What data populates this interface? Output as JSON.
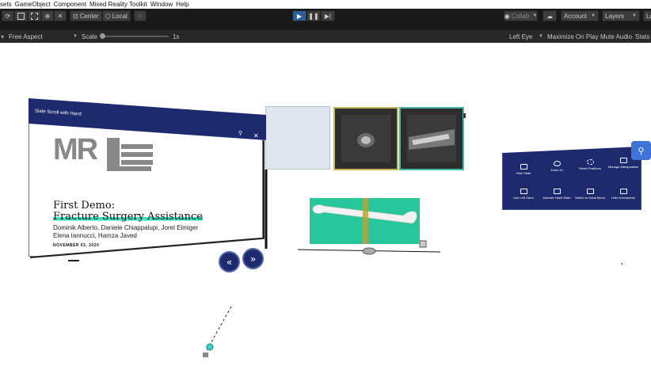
{
  "menubar": {
    "items": [
      "sets",
      "GameObject",
      "Component",
      "Mixed Reality Toolkit",
      "Window",
      "Help"
    ]
  },
  "toolbar": {
    "pivot": "Center",
    "space": "Local",
    "collab": "Collab",
    "account": "Account",
    "layers": "Layers",
    "layout": "La"
  },
  "gameview": {
    "display": "Free Aspect",
    "scale_label": "Scale",
    "scale_value": "1x",
    "eye": "Left Eye",
    "maximize": "Maximize On Play",
    "mute": "Mute Audio",
    "stats": "Stats"
  },
  "slate": {
    "title": "Slate Scroll with Hand",
    "logo_left": "MR",
    "demo_line1": "First Demo:",
    "demo_line2": "Fracture Surgery Assistance",
    "authors_line1": "Dominik Alberto, Daniele Chiappalupi, Jorel Elmiger",
    "authors_line2": "Elena Iannucci, Hamza Javed",
    "date": "NOVEMBER 03, 2020"
  },
  "hand_menu": {
    "items": [
      {
        "label": "Hide Slate",
        "icon": "slate-icon"
      },
      {
        "label": "Zoom 2x",
        "icon": "zoom-icon"
      },
      {
        "label": "Reset Positions",
        "icon": "reset-icon"
      },
      {
        "label": "Manage Manipulation",
        "icon": "manipulation-icon"
      },
      {
        "label": "Use Left Hand",
        "icon": "hand-icon"
      },
      {
        "label": "Activate Hand Slate",
        "icon": "hand-slate-icon"
      },
      {
        "label": "Switch to Hand Menu",
        "icon": "menu-icon"
      },
      {
        "label": "Hide Documents",
        "icon": "documents-icon"
      }
    ]
  },
  "colors": {
    "slate_header": "#1e2a6e",
    "highlight": "#3fe0c0",
    "bone_panel": "#27c79b",
    "tile_yellow_border": "#c7b85a",
    "tile_teal_border": "#46b8a8",
    "pin_button": "#3f73d8"
  }
}
